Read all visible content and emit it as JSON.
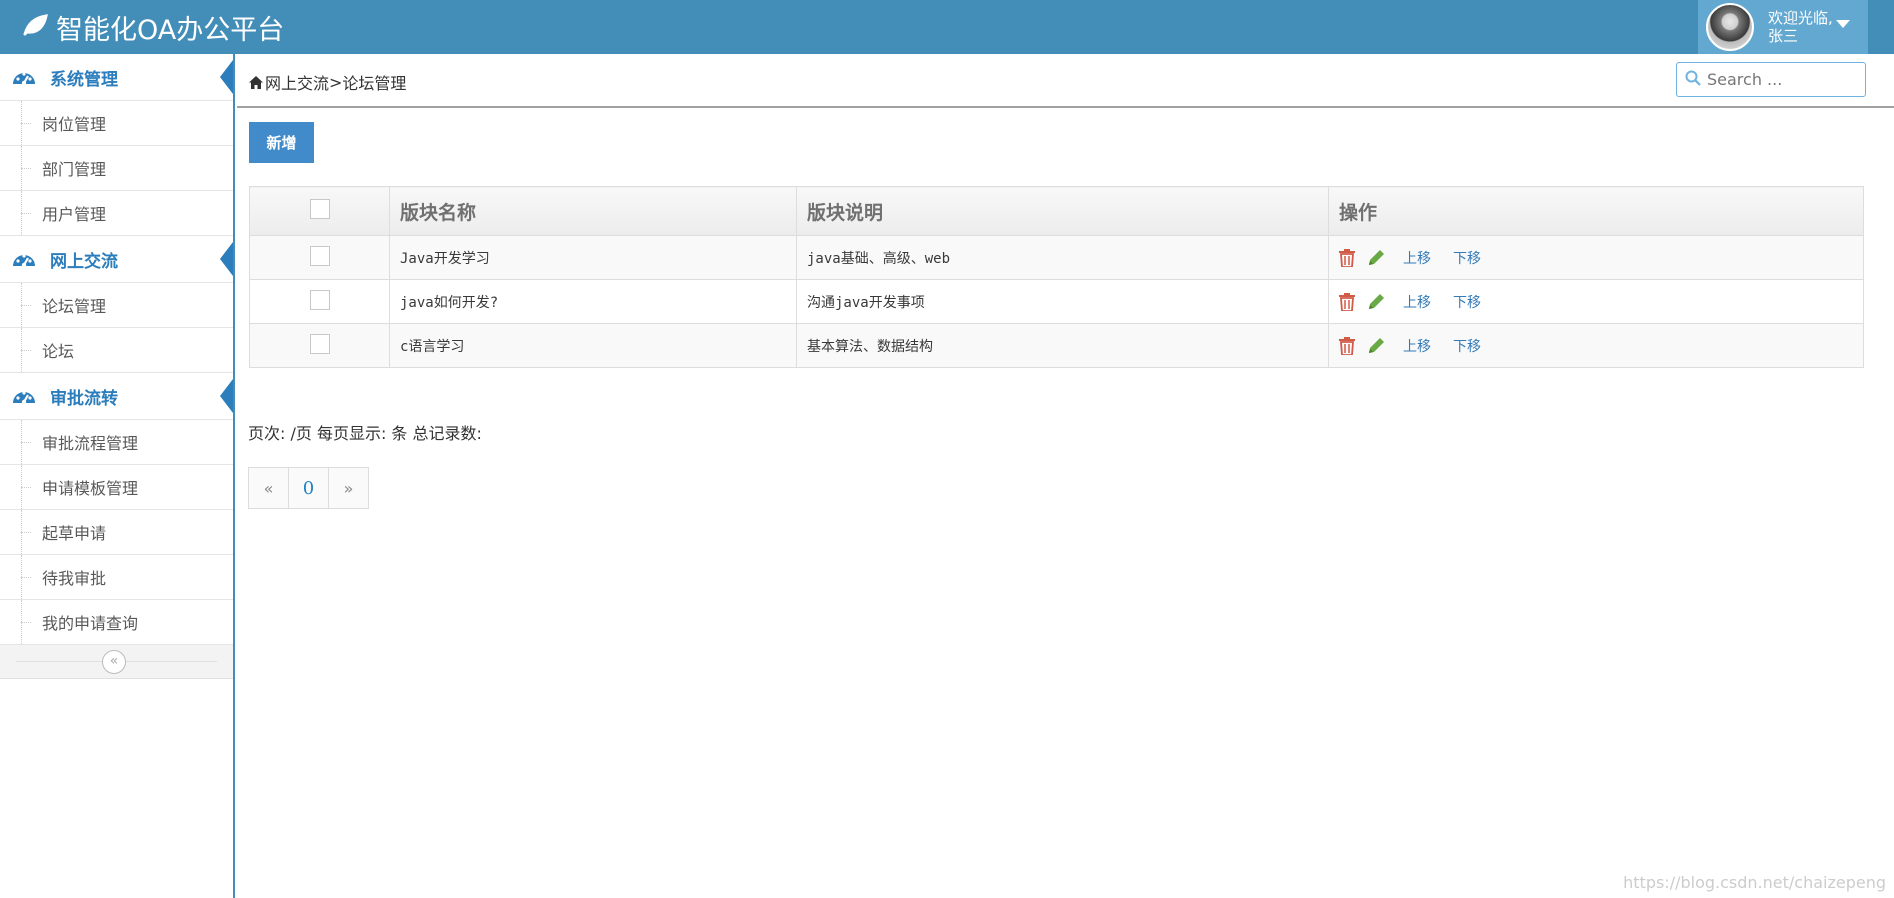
{
  "app": {
    "title": "智能化OA办公平台"
  },
  "user": {
    "greeting": "欢迎光临,",
    "name": "张三"
  },
  "sidebar": {
    "groups": [
      {
        "label": "系统管理",
        "items": [
          "岗位管理",
          "部门管理",
          "用户管理"
        ]
      },
      {
        "label": "网上交流",
        "items": [
          "论坛管理",
          "论坛"
        ]
      },
      {
        "label": "审批流转",
        "items": [
          "审批流程管理",
          "申请模板管理",
          "起草申请",
          "待我审批",
          "我的申请查询"
        ]
      }
    ]
  },
  "breadcrumb": {
    "parent": "网上交流",
    "sep": ">",
    "current": "论坛管理"
  },
  "search": {
    "placeholder": "Search ..."
  },
  "toolbar": {
    "new_label": "新增"
  },
  "table": {
    "headers": [
      "",
      "版块名称",
      "版块说明",
      "操作"
    ],
    "rows": [
      {
        "name": "Java开发学习",
        "desc": "java基础、高级、web",
        "up": "上移",
        "down": "下移"
      },
      {
        "name": "java如何开发?",
        "desc": "沟通java开发事项",
        "up": "上移",
        "down": "下移"
      },
      {
        "name": "c语言学习",
        "desc": "基本算法、数据结构",
        "up": "上移",
        "down": "下移"
      }
    ]
  },
  "pagination": {
    "info": "页次: /页   每页显示: 条  总记录数:",
    "prev": "«",
    "page": "0",
    "next": "»"
  },
  "watermark": "https://blog.csdn.net/chaizepeng",
  "colors": {
    "navbar": "#438eb9",
    "accent": "#2b7dbc",
    "delete": "#d15b47",
    "edit": "#69aa46"
  }
}
